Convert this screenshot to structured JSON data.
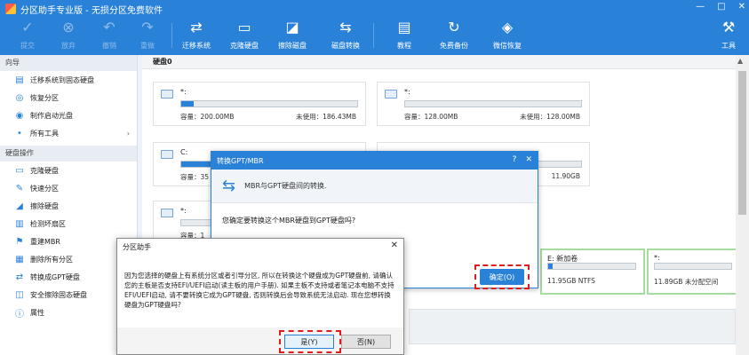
{
  "app": {
    "title": "分区助手专业版 - 无损分区免费软件"
  },
  "window_controls": [
    "—",
    "□",
    "✕"
  ],
  "toolbar": {
    "items": [
      {
        "label": "提交",
        "icon": "check-icon",
        "enabled": false
      },
      {
        "label": "放弃",
        "icon": "close-icon",
        "enabled": false
      },
      {
        "label": "撤销",
        "icon": "undo-icon",
        "enabled": false
      },
      {
        "label": "重做",
        "icon": "redo-icon",
        "enabled": false
      },
      {
        "label": "迁移系统",
        "icon": "migrate-icon",
        "enabled": true
      },
      {
        "label": "克隆硬盘",
        "icon": "clone-disk-icon",
        "enabled": true
      },
      {
        "label": "擦除磁盘",
        "icon": "wipe-disk-icon",
        "enabled": true
      },
      {
        "label": "磁盘转换",
        "icon": "disk-convert-icon",
        "enabled": true
      },
      {
        "label": "教程",
        "icon": "tutorial-icon",
        "enabled": true
      },
      {
        "label": "免费备份",
        "icon": "backup-icon",
        "enabled": true
      },
      {
        "label": "微信恢复",
        "icon": "wechat-recovery-icon",
        "enabled": true
      },
      {
        "label": "工具",
        "icon": "tools-icon",
        "enabled": true
      }
    ]
  },
  "sidebar": {
    "wizard_title": "向导",
    "wizard_items": [
      "迁移系统到固态硬盘",
      "恢复分区",
      "制作启动光盘",
      "所有工具"
    ],
    "disk_ops_title": "硬盘操作",
    "disk_ops_items": [
      "克隆硬盘",
      "快速分区",
      "擦除硬盘",
      "检测坏扇区",
      "重建MBR",
      "删除所有分区",
      "转换成GPT硬盘",
      "安全擦除固态硬盘",
      "属性"
    ]
  },
  "main": {
    "disk_label": "硬盘0",
    "partitions": [
      {
        "name": "*:",
        "capacity": "容量：200.00MB",
        "free": "未使用：186.43MB",
        "used_fraction": 0.07
      },
      {
        "name": "*:",
        "capacity": "容量：128.00MB",
        "free": "未使用：128.00MB",
        "used_fraction": 0.0
      },
      {
        "name": "C:",
        "capacity": "容量：35",
        "free": "",
        "used_fraction": 0.6
      },
      {
        "name": "",
        "capacity": "",
        "free": "11.90GB",
        "used_fraction": 0.0
      },
      {
        "name": "*:",
        "capacity": "容量：1",
        "free": "",
        "used_fraction": 0.0
      }
    ],
    "bottom_partitions": [
      {
        "name": "E: 新加卷",
        "info": "11.95GB NTFS",
        "used_fraction": 0.05
      },
      {
        "name": "*:",
        "info": "11.89GB 未分配空间",
        "used_fraction": 0.0
      }
    ]
  },
  "dialog_convert": {
    "title": "转换GPT/MBR",
    "help": "?",
    "close": "✕",
    "description": "MBR与GPT硬盘间的转换.",
    "question": "您确定要转换这个MBR硬盘到GPT硬盘吗?",
    "ok_label": "确定(O)"
  },
  "dialog_confirm": {
    "title": "分区助手",
    "close": "✕",
    "message": "因为您选择的硬盘上有系统分区或者引导分区, 所以在转换这个硬盘成为GPT硬盘前, 请确认您的主板是否支持EFI/UEFI启动(读主板的用户手册). 如果主板不支持或者笔记本电脑不支持EFI/UEFI启动, 请不要转换它成为GPT硬盘, 否则转换后会导致系统无法启动. 现在您想转换硬盘为GPT硬盘吗?",
    "yes_label": "是(Y)",
    "no_label": "否(N)"
  },
  "colors": {
    "accent": "#2a82d8",
    "highlight": "#e01b1b",
    "partition_border_green": "#a7dca0"
  }
}
